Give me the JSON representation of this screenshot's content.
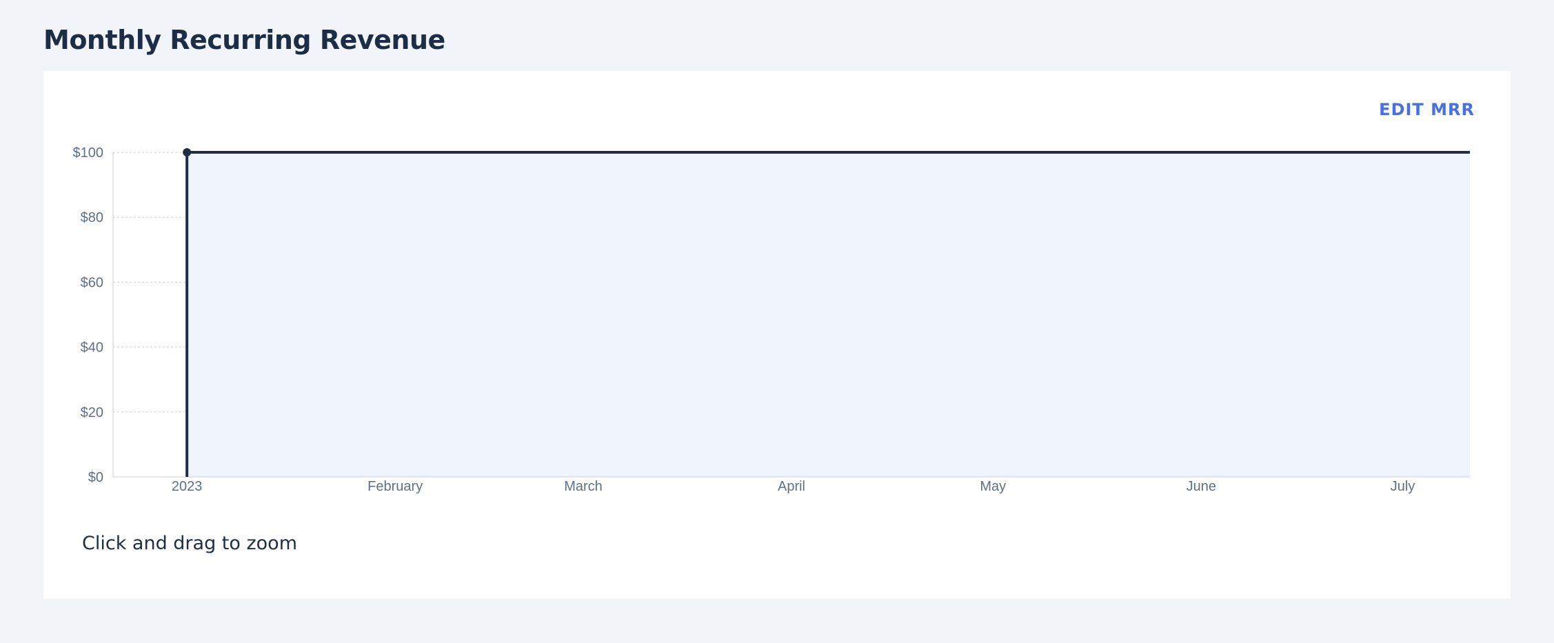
{
  "page": {
    "title": "Monthly Recurring Revenue"
  },
  "card": {
    "edit_label": "EDIT MRR",
    "hint": "Click and drag to zoom"
  },
  "chart_data": {
    "type": "area",
    "x_tick_labels": [
      "2023",
      "February",
      "March",
      "April",
      "May",
      "June",
      "July"
    ],
    "y_tick_labels": [
      "$0",
      "$20",
      "$40",
      "$60",
      "$80",
      "$100"
    ],
    "ylim": [
      0,
      100
    ],
    "xlim": [
      "2022-12-21",
      "2023-07-11"
    ],
    "series": [
      {
        "x": [
          "2023-01-01",
          "2023-07-11"
        ],
        "values": [
          100,
          100
        ]
      }
    ],
    "x_tick_dates": [
      "2023-01-01",
      "2023-02-01",
      "2023-03-01",
      "2023-04-01",
      "2023-05-01",
      "2023-06-01",
      "2023-07-01"
    ],
    "colors": {
      "line": "#1c2d45",
      "fill": "#eff3fc",
      "grid": "#c9d0dc"
    },
    "grid": true,
    "legend": "none"
  }
}
